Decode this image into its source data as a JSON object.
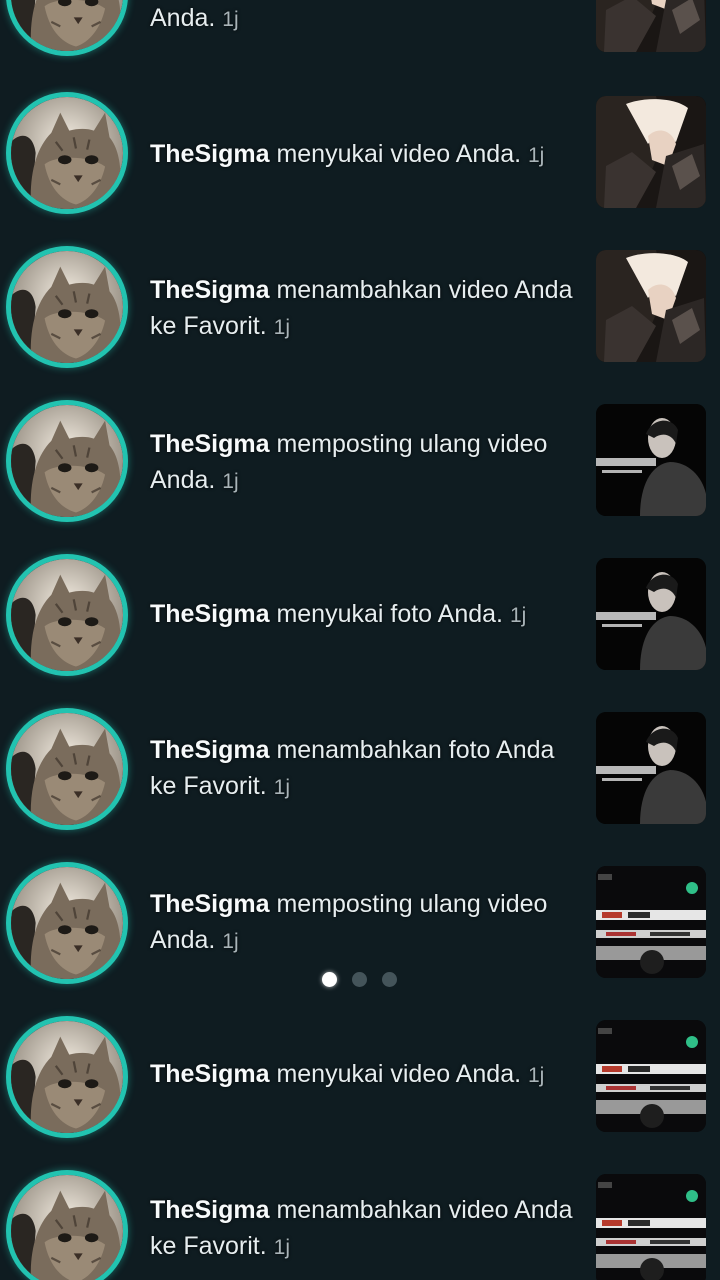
{
  "notifications": [
    {
      "user": "",
      "action": "Anda.",
      "time": "1j",
      "thumb": "mirror-selfie-light"
    },
    {
      "user": "TheSigma",
      "action": "menyukai video Anda.",
      "time": "1j",
      "thumb": "mirror-selfie-light"
    },
    {
      "user": "TheSigma",
      "action": "menambahkan video Anda ke Favorit.",
      "time": "1j",
      "thumb": "mirror-selfie-light"
    },
    {
      "user": "TheSigma",
      "action": "memposting ulang video Anda.",
      "time": "1j",
      "thumb": "dark-portrait"
    },
    {
      "user": "TheSigma",
      "action": "menyukai foto Anda.",
      "time": "1j",
      "thumb": "dark-portrait"
    },
    {
      "user": "TheSigma",
      "action": "menambahkan foto Anda ke Favorit.",
      "time": "1j",
      "thumb": "dark-portrait"
    },
    {
      "user": "TheSigma",
      "action": "memposting ulang video Anda.",
      "time": "1j",
      "thumb": "screenshot-dark"
    },
    {
      "user": "TheSigma",
      "action": "menyukai video Anda.",
      "time": "1j",
      "thumb": "screenshot-dark"
    },
    {
      "user": "TheSigma",
      "action": "menambahkan video Anda ke Favorit.",
      "time": "1j",
      "thumb": "screenshot-dark"
    }
  ],
  "avatar_icon": "cat-avatar-icon",
  "pager": {
    "count": 3,
    "active_index": 0
  },
  "colors": {
    "background": "#0f1c21",
    "avatar_ring": "#22c3b0",
    "text": "#e6edef",
    "time": "#a9b4b8",
    "dot_active": "#ffffff",
    "dot_inactive": "#44545a"
  }
}
